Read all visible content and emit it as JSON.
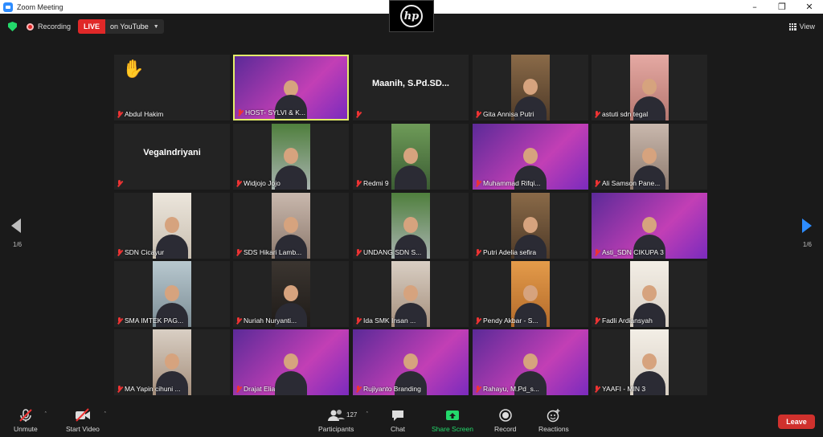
{
  "window": {
    "title": "Zoom Meeting"
  },
  "hp_badge": "hp",
  "topbar": {
    "recording_label": "Recording",
    "live_label": "LIVE",
    "live_target": "on YouTube",
    "view_label": "View"
  },
  "participants_grid": [
    {
      "name": "Abdul Hakim",
      "video": "none",
      "hand_raised": true,
      "active_speaker": false
    },
    {
      "name": "HOST- SYLVI & K...",
      "video": "purple",
      "hand_raised": false,
      "active_speaker": true
    },
    {
      "name": "",
      "display_name": "Maanih,  S.Pd.SD...",
      "video": "none",
      "hand_raised": false,
      "active_speaker": false
    },
    {
      "name": "Gita Annisa Putri",
      "video": "wood",
      "hand_raised": false,
      "active_speaker": false
    },
    {
      "name": "astuti sdn tegal",
      "video": "pink",
      "hand_raised": false,
      "active_speaker": false
    },
    {
      "name": "",
      "display_name": "VegaIndriyani",
      "video": "none",
      "hand_raised": false,
      "active_speaker": false
    },
    {
      "name": "Widjojo Jojo",
      "video": "trees",
      "hand_raised": false,
      "active_speaker": false
    },
    {
      "name": "Redmi 9",
      "video": "green",
      "hand_raised": false,
      "active_speaker": false
    },
    {
      "name": "Muhammad Rifqi...",
      "video": "purple",
      "hand_raised": false,
      "active_speaker": false
    },
    {
      "name": "Ali Samson Pane...",
      "video": "wall",
      "hand_raised": false,
      "active_speaker": false
    },
    {
      "name": "SDN Cicayur",
      "video": "cream",
      "hand_raised": false,
      "active_speaker": false
    },
    {
      "name": "SDS Hikari Lamb...",
      "video": "wall",
      "hand_raised": false,
      "active_speaker": false
    },
    {
      "name": "UNDANG SDN S...",
      "video": "trees",
      "hand_raised": false,
      "active_speaker": false
    },
    {
      "name": "Putri Adelia sefira",
      "video": "wood",
      "hand_raised": false,
      "active_speaker": false
    },
    {
      "name": "Asti_SDN CIKUPA 3",
      "video": "purple",
      "hand_raised": false,
      "active_speaker": false
    },
    {
      "name": "SMA IMTEK PAG...",
      "video": "blue",
      "hand_raised": false,
      "active_speaker": false
    },
    {
      "name": "Nuriah Nuryanti...",
      "video": "dark",
      "hand_raised": false,
      "active_speaker": false
    },
    {
      "name": "Ida SMK Insan ...",
      "video": "room",
      "hand_raised": false,
      "active_speaker": false
    },
    {
      "name": "Pendy Akbar - S...",
      "video": "orange",
      "hand_raised": false,
      "active_speaker": false
    },
    {
      "name": "Fadli Ardiansyah",
      "video": "ivory",
      "hand_raised": false,
      "active_speaker": false
    },
    {
      "name": "MA Yapin cihuni ...",
      "video": "room",
      "hand_raised": false,
      "active_speaker": false
    },
    {
      "name": "Drajat Elia",
      "video": "purple",
      "hand_raised": false,
      "active_speaker": false
    },
    {
      "name": "Rujiyanto Branding",
      "video": "purple",
      "hand_raised": false,
      "active_speaker": false
    },
    {
      "name": "Rahayu, M.Pd_s...",
      "video": "purple",
      "hand_raised": false,
      "active_speaker": false
    },
    {
      "name": "YAAFI - MIN 3",
      "video": "ivory",
      "hand_raised": false,
      "active_speaker": false
    }
  ],
  "pagination": {
    "left": "1/6",
    "right": "1/6"
  },
  "toolbar": {
    "unmute": "Unmute",
    "start_video": "Start Video",
    "participants": "Participants",
    "participants_count": "127",
    "chat": "Chat",
    "share_screen": "Share Screen",
    "record": "Record",
    "reactions": "Reactions",
    "leave": "Leave"
  },
  "colors": {
    "live": "#e02828",
    "share_green": "#23d96b",
    "leave_red": "#d0312d",
    "active_border": "#e4ee6a",
    "nav_blue": "#2d8cff"
  }
}
